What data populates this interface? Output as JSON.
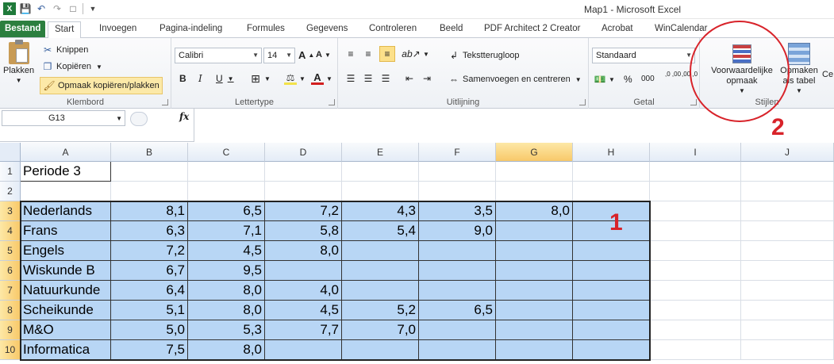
{
  "app": {
    "window_title": "Map1  -  Microsoft Excel",
    "qat_icons": [
      "excel-icon",
      "save-icon",
      "undo-icon",
      "redo-icon",
      "new-document-icon",
      "customize-qat-icon"
    ]
  },
  "tabs": [
    "Bestand",
    "Start",
    "Invoegen",
    "Pagina-indeling",
    "Formules",
    "Gegevens",
    "Controleren",
    "Beeld",
    "PDF Architect 2 Creator",
    "Acrobat",
    "WinCalendar"
  ],
  "ribbon": {
    "clipboard": {
      "label": "Klembord",
      "paste": "Plakken",
      "cut": "Knippen",
      "copy": "Kopiëren",
      "format_painter": "Opmaak kopiëren/plakken"
    },
    "font": {
      "label": "Lettertype",
      "name": "Calibri",
      "size": "14",
      "bold": "B",
      "italic": "I",
      "underline": "U",
      "grow": "A",
      "shrink": "A"
    },
    "alignment": {
      "label": "Uitlijning",
      "wrap": "Tekstterugloop",
      "merge": "Samenvoegen en centreren"
    },
    "number": {
      "label": "Getal",
      "format": "Standaard",
      "percent": "%",
      "thousands": "000",
      "inc_decimals": ",0 ,00",
      "dec_decimals": ",00 ,0"
    },
    "styles": {
      "label": "Stijlen",
      "conditional": "Voorwaardelijke opmaak",
      "as_table": "Opmaken als tabel",
      "cell_styles": "Ce"
    }
  },
  "formula_bar": {
    "name_box": "G13",
    "fx": "fx",
    "value": ""
  },
  "sheet": {
    "columns": [
      "A",
      "B",
      "C",
      "D",
      "E",
      "F",
      "G",
      "H",
      "I",
      "J"
    ],
    "selected_column": "G",
    "rows": [
      "1",
      "2",
      "3",
      "4",
      "5",
      "6",
      "7",
      "8",
      "9",
      "10"
    ],
    "a1": "Periode 3",
    "data": [
      {
        "label": "Nederlands",
        "values": [
          "8,1",
          "6,5",
          "7,2",
          "4,3",
          "3,5",
          "8,0"
        ]
      },
      {
        "label": "Frans",
        "values": [
          "6,3",
          "7,1",
          "5,8",
          "5,4",
          "9,0",
          ""
        ]
      },
      {
        "label": "Engels",
        "values": [
          "7,2",
          "4,5",
          "8,0",
          "",
          "",
          ""
        ]
      },
      {
        "label": "Wiskunde B",
        "values": [
          "6,7",
          "9,5",
          "",
          "",
          "",
          ""
        ]
      },
      {
        "label": "Natuurkunde",
        "values": [
          "6,4",
          "8,0",
          "4,0",
          "",
          "",
          ""
        ]
      },
      {
        "label": "Scheikunde",
        "values": [
          "5,1",
          "8,0",
          "4,5",
          "5,2",
          "6,5",
          ""
        ]
      },
      {
        "label": "M&O",
        "values": [
          "5,0",
          "5,3",
          "7,7",
          "7,0",
          "",
          ""
        ]
      },
      {
        "label": "Informatica",
        "values": [
          "7,5",
          "8,0",
          "",
          "",
          "",
          ""
        ]
      }
    ]
  },
  "annotations": {
    "marker_1": "1",
    "marker_2": "2",
    "color": "#d8232a"
  },
  "colors": {
    "file_tab": "#2c7f3f",
    "selection_fill": "#b8d6f5",
    "header_highlight": "#f8c96a"
  }
}
